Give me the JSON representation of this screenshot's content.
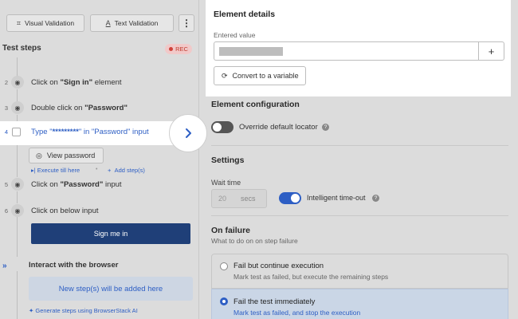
{
  "toolbar": {
    "visual_validation": "Visual Validation",
    "text_validation": "Text Validation",
    "more": "⋮"
  },
  "steps_panel": {
    "title": "Test steps",
    "rec_label": "REC",
    "steps": [
      {
        "num": "2",
        "prefix": "Click on ",
        "bold": "\"Sign in\"",
        "suffix": " element"
      },
      {
        "num": "3",
        "prefix": "Double click on ",
        "bold": "\"Password\"",
        "suffix": ""
      },
      {
        "num": "4",
        "prefix": "Type \"",
        "bold": "*********",
        "suffix": "\" in \"Password\" input"
      },
      {
        "num": "5",
        "prefix": "Click on ",
        "bold": "\"Password\"",
        "suffix": " input"
      },
      {
        "num": "6",
        "prefix": "Click on below input",
        "bold": "",
        "suffix": ""
      }
    ],
    "view_password": "View password",
    "execute_till_here": "Execute till here",
    "add_steps": "Add step(s)",
    "sign_me_in": "Sign me in",
    "interact_title": "Interact with the browser",
    "new_steps_hint": "New step(s) will be added here",
    "ai_link": "Generate steps using BrowserStack AI"
  },
  "element_details": {
    "title": "Element details",
    "entered_value_label": "Entered value",
    "convert_button": "Convert to a variable"
  },
  "configuration": {
    "title": "Element configuration",
    "override_label": "Override default locator",
    "override_on": false
  },
  "settings": {
    "title": "Settings",
    "wait_time_label": "Wait time",
    "wait_placeholder": "20",
    "wait_unit": "secs",
    "intelligent_timeout_label": "Intelligent time-out",
    "intelligent_timeout_on": true
  },
  "on_failure": {
    "title": "On failure",
    "subtitle": "What to do on on step failure",
    "options": [
      {
        "title": "Fail but continue execution",
        "desc": "Mark test as failed, but execute the remaining steps",
        "selected": false
      },
      {
        "title": "Fail the test immediately",
        "desc": "Mark test as failed, and stop the execution",
        "selected": true
      }
    ]
  },
  "colors": {
    "accent": "#2d5ec4",
    "primary_button": "#1f3f78",
    "rec": "#d0433b"
  }
}
